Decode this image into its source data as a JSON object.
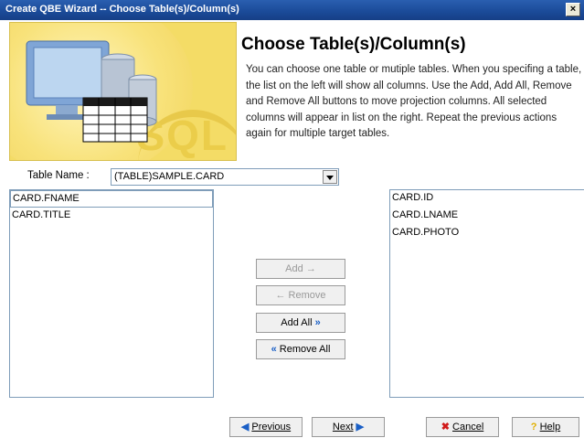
{
  "window": {
    "title": "Create QBE Wizard -- Choose Table(s)/Column(s)",
    "close_label": "×"
  },
  "banner": {
    "watermark_text": "SQL"
  },
  "header": {
    "heading": "Choose Table(s)/Column(s)",
    "description": "You can choose one table or mutiple tables. When you specifing a table, the list on the left will show all columns. Use the Add, Add All, Remove and Remove All buttons to move projection columns. All selected columns will appear in list on the right. Repeat the previous actions again for multiple target tables."
  },
  "table_name": {
    "label": "Table Name :",
    "selected_value": "(TABLE)SAMPLE.CARD"
  },
  "available_columns": [
    "CARD.FNAME",
    "CARD.TITLE"
  ],
  "selected_columns": [
    "CARD.ID",
    "CARD.LNAME",
    "CARD.PHOTO"
  ],
  "move_buttons": {
    "add": "Add",
    "remove": "Remove",
    "add_all": "Add All",
    "remove_all": "Remove All"
  },
  "footer": {
    "previous": "Previous",
    "next": "Next",
    "cancel": "Cancel",
    "help": "Help"
  },
  "icons": {
    "add": "right-arrow-icon",
    "remove": "left-arrow-icon",
    "add_all": "double-right-arrow-icon",
    "remove_all": "double-left-arrow-icon",
    "cancel": "red-x-icon",
    "help": "question-mark-icon"
  }
}
